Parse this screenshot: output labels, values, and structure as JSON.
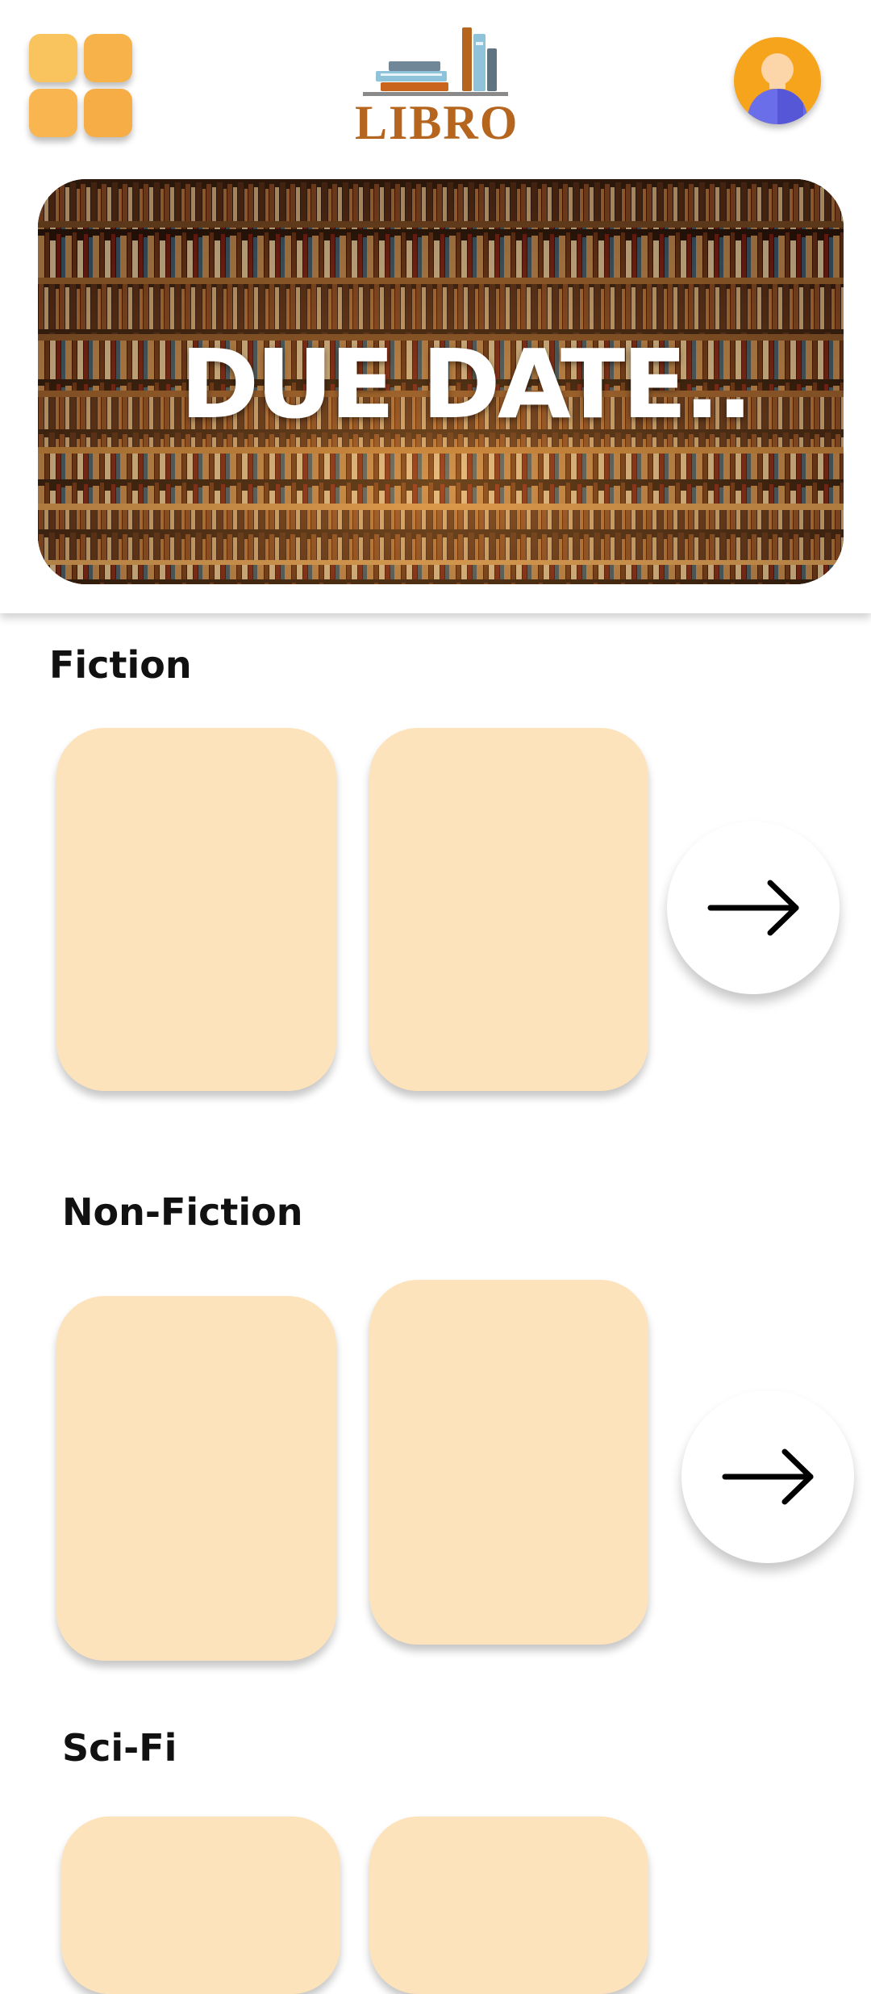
{
  "header": {
    "menu_icon": "grid-menu-icon",
    "logo_text": "LIBRO",
    "profile_icon": "user-avatar-icon"
  },
  "banner": {
    "title": "DUE DATE.."
  },
  "sections": [
    {
      "title": "Fiction",
      "next_icon": "arrow-right-icon"
    },
    {
      "title": "Non-Fiction",
      "next_icon": "arrow-right-icon"
    },
    {
      "title": "Sci-Fi"
    }
  ],
  "colors": {
    "accent": "#f8b64c",
    "card": "#fde3bb",
    "logo": "#b5651d",
    "avatar": "#f6a41c"
  }
}
